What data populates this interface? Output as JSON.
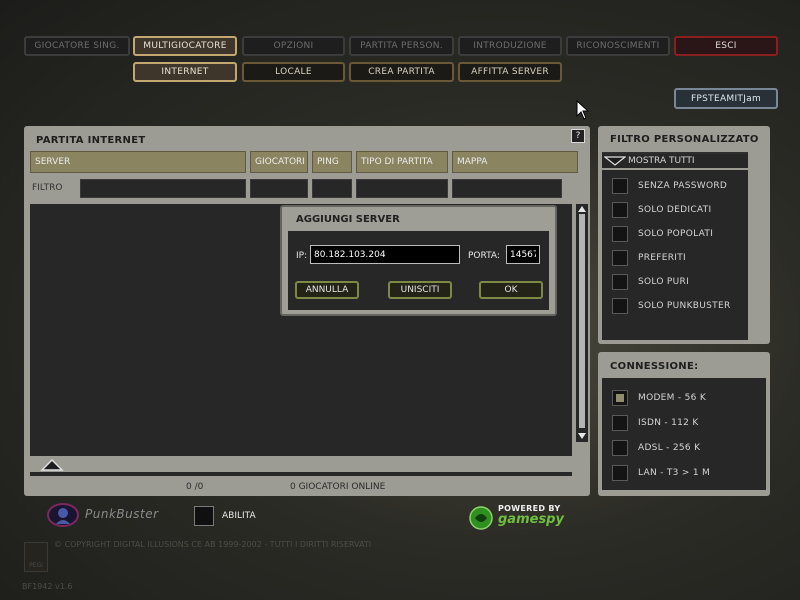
{
  "nav_top": [
    {
      "label": "GIOCATORE SING.",
      "state": "inactive"
    },
    {
      "label": "MULTIGIOCATORE",
      "state": "active"
    },
    {
      "label": "OPZIONI",
      "state": "inactive"
    },
    {
      "label": "PARTITA PERSON.",
      "state": "inactive"
    },
    {
      "label": "INTRODUZIONE",
      "state": "inactive"
    },
    {
      "label": "RICONOSCIMENTI",
      "state": "inactive"
    },
    {
      "label": "ESCI",
      "state": "exit"
    }
  ],
  "nav_sub": [
    {
      "label": "INTERNET",
      "state": "active"
    },
    {
      "label": "LOCALE",
      "state": "lit"
    },
    {
      "label": "CREA PARTITA",
      "state": "lit"
    },
    {
      "label": "AFFITTA SERVER",
      "state": "lit"
    }
  ],
  "user_button": "FPSTEAMITJam",
  "browser": {
    "title": "PARTITA INTERNET",
    "help": "?",
    "columns": [
      "SERVER",
      "GIOCATORI",
      "PING",
      "TIPO DI PARTITA",
      "MAPPA"
    ],
    "filter_label": "FILTRO",
    "server_count": "0 /0",
    "players_online": "0  GIOCATORI ONLINE"
  },
  "dialog": {
    "title": "AGGIUNGI SERVER",
    "ip_label": "IP:",
    "ip_value": "80.182.103.204",
    "port_label": "PORTA:",
    "port_value": "14567",
    "cancel": "ANNULLA",
    "join": "UNISCITI",
    "ok": "OK"
  },
  "custom_filter": {
    "title": "FILTRO PERSONALIZZATO",
    "show_all": "MOSTRA TUTTI",
    "options": [
      {
        "label": "SENZA PASSWORD",
        "checked": false
      },
      {
        "label": "SOLO DEDICATI",
        "checked": false
      },
      {
        "label": "SOLO POPOLATI",
        "checked": false
      },
      {
        "label": "PREFERITI",
        "checked": false
      },
      {
        "label": "SOLO PURI",
        "checked": false
      },
      {
        "label": "SOLO PUNKBUSTER",
        "checked": false
      }
    ]
  },
  "connection": {
    "title": "CONNESSIONE:",
    "options": [
      {
        "label": "MODEM - 56 K",
        "checked": true
      },
      {
        "label": "ISDN - 112 K",
        "checked": false
      },
      {
        "label": "ADSL - 256 K",
        "checked": false
      },
      {
        "label": "LAN - T3 > 1 M",
        "checked": false
      }
    ]
  },
  "punkbuster": {
    "logo": "PunkBuster",
    "enable_label": "ABILITA"
  },
  "gamespy": {
    "powered": "POWERED BY",
    "brand": "gamespy"
  },
  "copyright": "© COPYRIGHT DIGITAL ILLUSIONS CE AB 1999-2002 - TUTTI I DIRITTI RISERVATI",
  "version": "BF1942 v1.6",
  "rating_badge": "PEGI"
}
